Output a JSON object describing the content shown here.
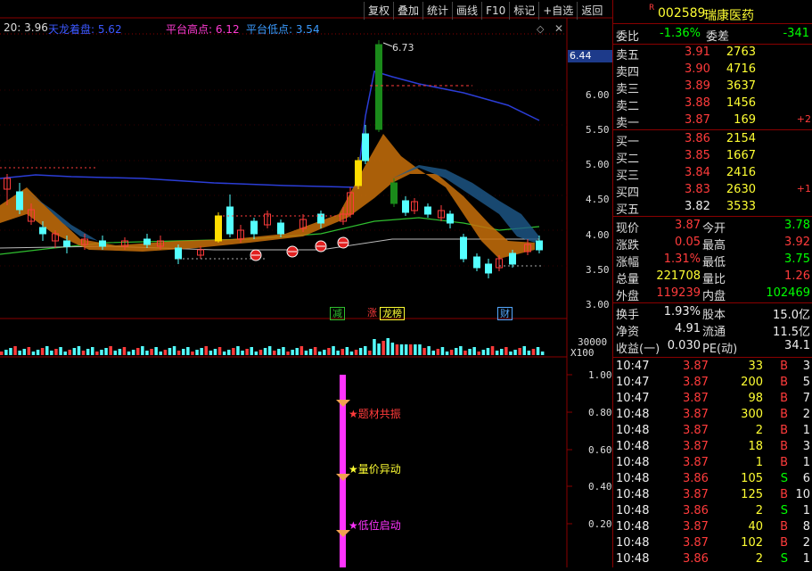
{
  "toolbar": {
    "buttons": [
      "复权",
      "叠加",
      "统计",
      "画线",
      "F10",
      "标记",
      "+自选",
      "返回"
    ]
  },
  "header": {
    "ma": "20: 3.96",
    "tianlong": "天龙着盘: 5.62",
    "plat_high": "平台高点: 6.12",
    "plat_low": "平台低点: 3.54"
  },
  "price_axis": [
    "6.00",
    "5.50",
    "5.00",
    "4.50",
    "4.00",
    "3.50",
    "3.00"
  ],
  "price_tag": "6.44",
  "peak_label": "6.73",
  "vol_axis": [
    "30000",
    "X100"
  ],
  "ind_axis": [
    "1.00",
    "0.80",
    "0.60",
    "0.40",
    "0.20"
  ],
  "event_tags": {
    "jian": "减",
    "zhang": "涨",
    "longhu": "龙榜",
    "cai": "财"
  },
  "signals": {
    "s1": "★题材共振",
    "s2": "★量价异动",
    "s3": "★低位启动"
  },
  "stock": {
    "badge": "R",
    "code": "002589",
    "name": "瑞康医药"
  },
  "weibi": {
    "label": "委比",
    "value": "-1.36%",
    "label2": "委差",
    "value2": "-341"
  },
  "sell": [
    {
      "label": "卖五",
      "price": "3.91",
      "vol": "2763",
      "chg": ""
    },
    {
      "label": "卖四",
      "price": "3.90",
      "vol": "4716",
      "chg": ""
    },
    {
      "label": "卖三",
      "price": "3.89",
      "vol": "3637",
      "chg": ""
    },
    {
      "label": "卖二",
      "price": "3.88",
      "vol": "1456",
      "chg": ""
    },
    {
      "label": "卖一",
      "price": "3.87",
      "vol": "169",
      "chg": "+2"
    }
  ],
  "buy": [
    {
      "label": "买一",
      "price": "3.86",
      "vol": "2154",
      "chg": ""
    },
    {
      "label": "买二",
      "price": "3.85",
      "vol": "1667",
      "chg": ""
    },
    {
      "label": "买三",
      "price": "3.84",
      "vol": "2416",
      "chg": ""
    },
    {
      "label": "买四",
      "price": "3.83",
      "vol": "2630",
      "chg": "+1"
    },
    {
      "label": "买五",
      "price": "3.82",
      "vol": "3533",
      "chg": ""
    }
  ],
  "quote": [
    {
      "l1": "现价",
      "v1": "3.87",
      "c1": "red",
      "l2": "今开",
      "v2": "3.78",
      "c2": "green"
    },
    {
      "l1": "涨跌",
      "v1": "0.05",
      "c1": "red",
      "l2": "最高",
      "v2": "3.92",
      "c2": "red"
    },
    {
      "l1": "涨幅",
      "v1": "1.31%",
      "c1": "red",
      "l2": "最低",
      "v2": "3.75",
      "c2": "green"
    },
    {
      "l1": "总量",
      "v1": "221708",
      "c1": "yellow",
      "l2": "量比",
      "v2": "1.26",
      "c2": "red"
    },
    {
      "l1": "外盘",
      "v1": "119239",
      "c1": "red",
      "l2": "内盘",
      "v2": "102469",
      "c2": "green"
    }
  ],
  "fin": [
    {
      "l1": "换手",
      "v1": "1.93%",
      "l2": "股本",
      "v2": "15.0亿"
    },
    {
      "l1": "净资",
      "v1": "4.91",
      "l2": "流通",
      "v2": "11.5亿"
    },
    {
      "l1": "收益(一)",
      "v1": "0.030",
      "l2": "PE(动)",
      "v2": "34.1"
    }
  ],
  "ticks": [
    {
      "t": "10:47",
      "p": "3.87",
      "v": "33",
      "s": "B",
      "n": "3"
    },
    {
      "t": "10:47",
      "p": "3.87",
      "v": "200",
      "s": "B",
      "n": "5"
    },
    {
      "t": "10:47",
      "p": "3.87",
      "v": "98",
      "s": "B",
      "n": "7"
    },
    {
      "t": "10:48",
      "p": "3.87",
      "v": "300",
      "s": "B",
      "n": "2"
    },
    {
      "t": "10:48",
      "p": "3.87",
      "v": "2",
      "s": "B",
      "n": "1"
    },
    {
      "t": "10:48",
      "p": "3.87",
      "v": "18",
      "s": "B",
      "n": "3"
    },
    {
      "t": "10:48",
      "p": "3.87",
      "v": "1",
      "s": "B",
      "n": "1"
    },
    {
      "t": "10:48",
      "p": "3.86",
      "v": "105",
      "s": "S",
      "n": "6"
    },
    {
      "t": "10:48",
      "p": "3.87",
      "v": "125",
      "s": "B",
      "n": "10"
    },
    {
      "t": "10:48",
      "p": "3.86",
      "v": "2",
      "s": "S",
      "n": "1"
    },
    {
      "t": "10:48",
      "p": "3.87",
      "v": "40",
      "s": "B",
      "n": "8"
    },
    {
      "t": "10:48",
      "p": "3.87",
      "v": "102",
      "s": "B",
      "n": "2"
    },
    {
      "t": "10:48",
      "p": "3.86",
      "v": "2",
      "s": "S",
      "n": "1"
    }
  ],
  "colors": {
    "up": "#ff3b3b",
    "down": "#54ffff",
    "ma_blue": "#2b3dd6",
    "ma_green": "#2fbf2f",
    "bg": "#000000",
    "grid": "#8a0000"
  }
}
